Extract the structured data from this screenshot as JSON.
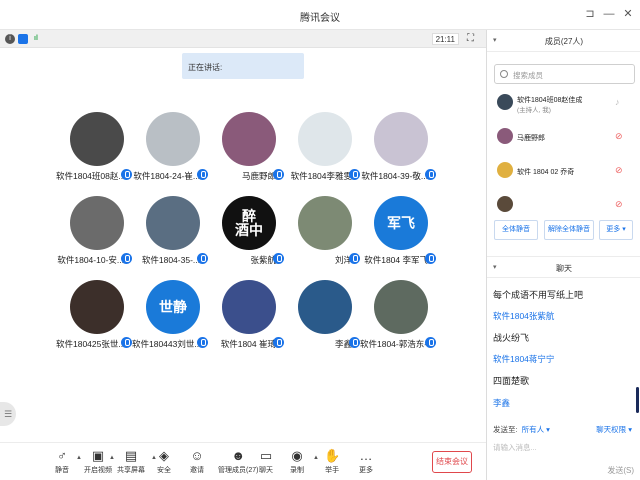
{
  "window": {
    "title": "腾讯会议",
    "controls": {
      "pin": "⊐",
      "minimize": "—",
      "close": "✕"
    }
  },
  "info_bar": {
    "time": "21:11"
  },
  "speaking": {
    "text": "正在讲话:"
  },
  "participants": [
    {
      "name": "软件1804班08赵...",
      "color": "#4a4a4a",
      "text": ""
    },
    {
      "name": "软件1804-24-崔...",
      "color": "#b9bfc5",
      "text": ""
    },
    {
      "name": "马鹿野郎",
      "color": "#8a5a7a",
      "text": ""
    },
    {
      "name": "软件1804李雅雯",
      "color": "#dfe6ea",
      "text": ""
    },
    {
      "name": "软件1804-39-敬...",
      "color": "#c9c3d3",
      "text": ""
    },
    {
      "name": "软件1804-10-安...",
      "color": "#6b6b6b",
      "text": ""
    },
    {
      "name": "软件1804-35-...",
      "color": "#5a6e82",
      "text": ""
    },
    {
      "name": "张紫航",
      "color": "#111111",
      "text": "醉\n酒中"
    },
    {
      "name": "刘洋",
      "color": "#7d8a74",
      "text": ""
    },
    {
      "name": "软件1804 李军飞",
      "color": "#1a7ad9",
      "text": "军飞"
    },
    {
      "name": "软件180425张世...",
      "color": "#3c2f2a",
      "text": ""
    },
    {
      "name": "软件180443刘世...",
      "color": "#1a7ad9",
      "text": "世静"
    },
    {
      "name": "软件1804 崔琦",
      "color": "#3b4f8c",
      "text": ""
    },
    {
      "name": "李鑫",
      "color": "#2a5a8a",
      "text": ""
    },
    {
      "name": "软件1804-郭浩东-28",
      "color": "#5e6a60",
      "text": ""
    }
  ],
  "toolbar": {
    "items": [
      {
        "label": "静音",
        "icon": "microphone-icon",
        "glyph": "♂"
      },
      {
        "label": "开启视频",
        "icon": "camera-off-icon",
        "glyph": "▣"
      },
      {
        "label": "共享屏幕",
        "icon": "share-screen-icon",
        "glyph": "▤"
      },
      {
        "label": "安全",
        "icon": "shield-icon",
        "glyph": "◈"
      },
      {
        "label": "邀请",
        "icon": "invite-icon",
        "glyph": "☺"
      },
      {
        "label": "管理成员(27)",
        "icon": "members-icon",
        "glyph": "☻"
      },
      {
        "label": "聊天",
        "icon": "chat-icon",
        "glyph": "▭"
      },
      {
        "label": "录制",
        "icon": "record-icon",
        "glyph": "◉"
      },
      {
        "label": "举手",
        "icon": "raise-hand-icon",
        "glyph": "✋"
      },
      {
        "label": "更多",
        "icon": "more-icon",
        "glyph": "…"
      }
    ],
    "end_label": "结束会议"
  },
  "members_panel": {
    "collapse": "▾",
    "title": "成员(27人)",
    "search_placeholder": "搜索成员",
    "members": [
      {
        "name": "软件1804班08赵佳成",
        "sub": "(主持人, 我)",
        "color": "#3a4a5a",
        "muted": false
      },
      {
        "name": "马鹿野郎",
        "sub": "",
        "color": "#8a5a7a",
        "muted": true
      },
      {
        "name": "软件 1804 02 乔奇",
        "sub": "",
        "color": "#e0b040",
        "muted": true
      },
      {
        "name": "",
        "sub": "",
        "color": "#5a4a3a",
        "muted": true
      }
    ],
    "buttons": [
      "全体静音",
      "解除全体静音",
      "更多 ▾"
    ]
  },
  "chat_panel": {
    "collapse": "▾",
    "title": "聊天",
    "messages": [
      {
        "text": "每个成语不用写纸上吧",
        "sender": false
      },
      {
        "text": "软件1804张紫航",
        "sender": true
      },
      {
        "text": "战火纷飞",
        "sender": false
      },
      {
        "text": "软件1804蒋宁宁",
        "sender": true
      },
      {
        "text": "四面楚歌",
        "sender": false
      },
      {
        "text": "李鑫",
        "sender": true
      }
    ],
    "send_to_label": "发送至:",
    "send_to_value": "所有人 ▾",
    "permission": "聊天权限 ▾",
    "input_placeholder": "请输入消息...",
    "send_label": "发送(S)"
  }
}
